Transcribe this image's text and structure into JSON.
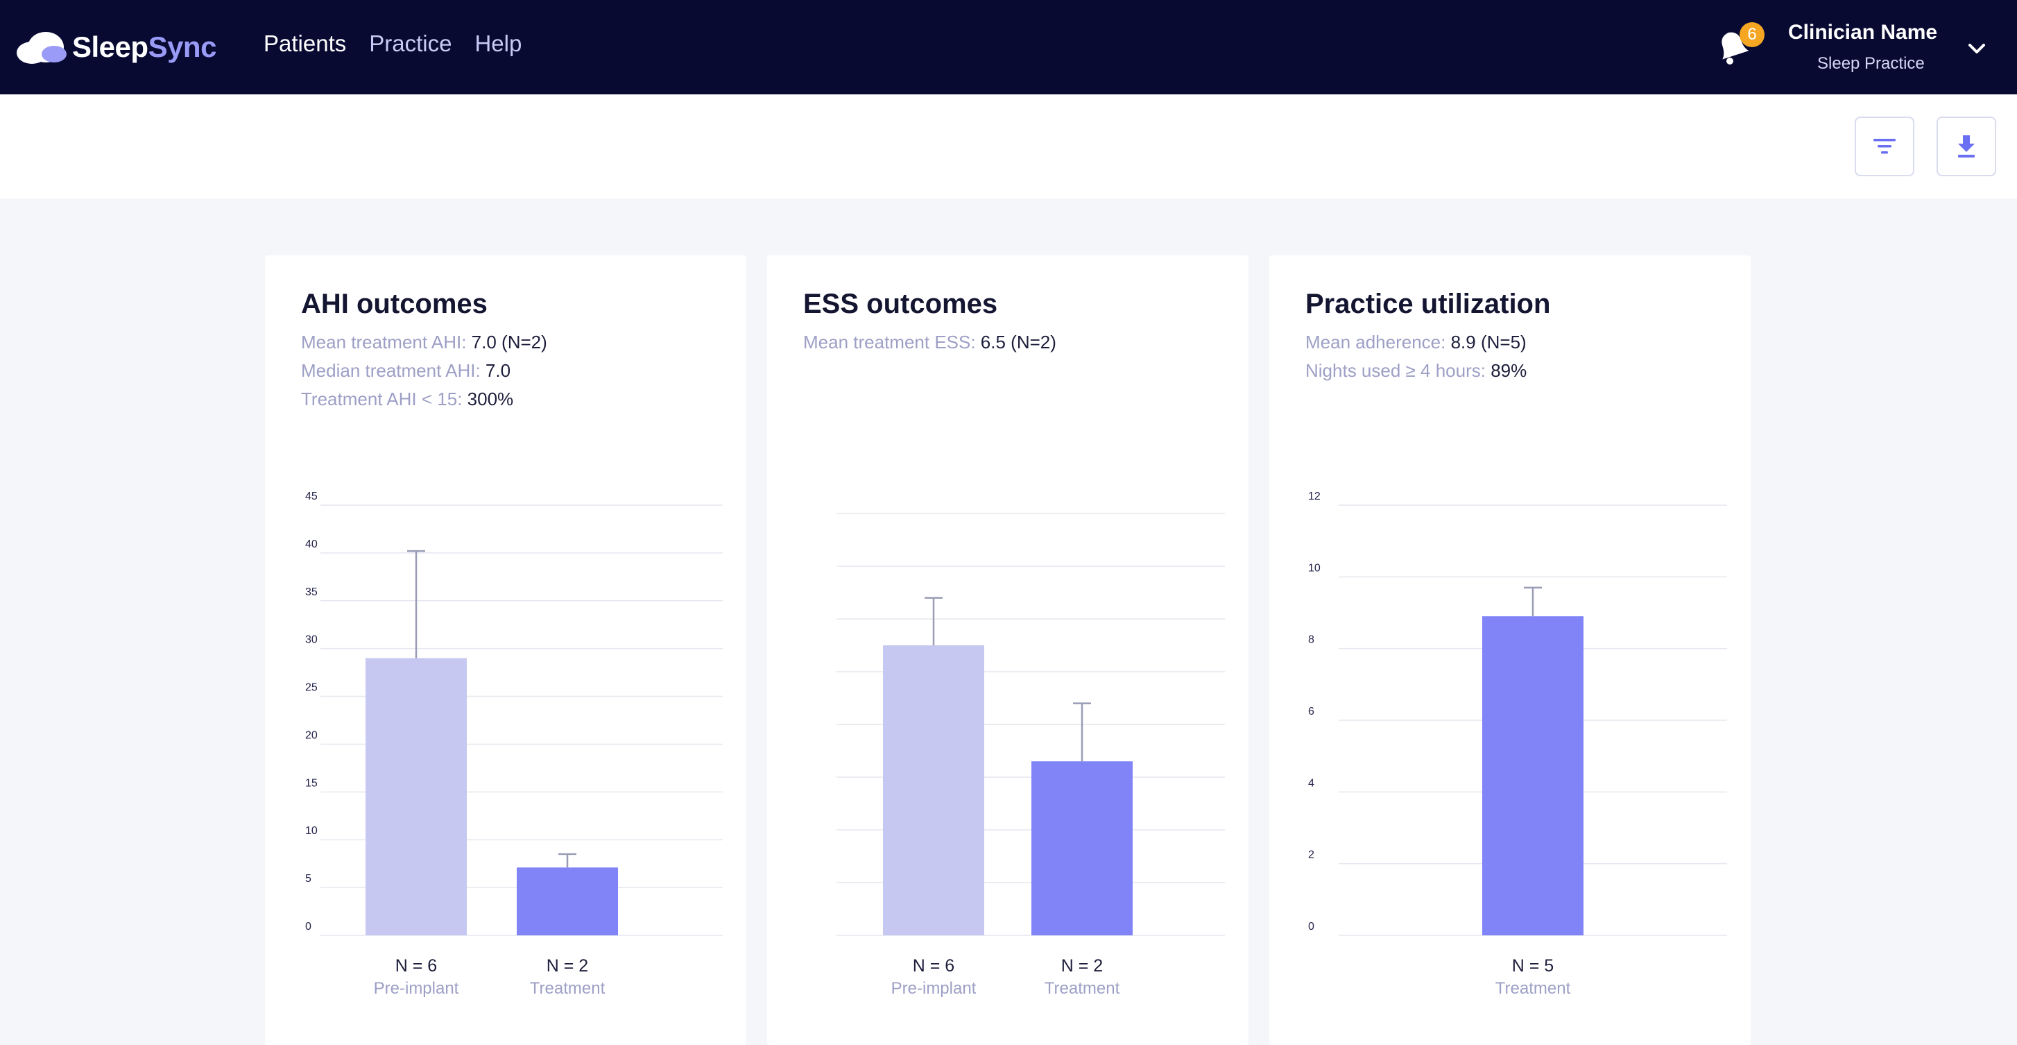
{
  "app": {
    "brand_part1": "Sleep",
    "brand_part2": "Sync",
    "nav": [
      "Patients",
      "Practice",
      "Help"
    ],
    "notifications_count": "6",
    "user_name": "Clinician Name",
    "user_org": "Sleep Practice",
    "icons": [
      "logo-cloud-icon",
      "bell-icon",
      "chevron-down-icon",
      "filter-icon",
      "download-icon"
    ],
    "colors": {
      "header_bg": "#080a32",
      "accent": "#8084f7",
      "accent_light": "#c7c8f2",
      "badge": "#f5a623"
    }
  },
  "cards": [
    {
      "title": "AHI outcomes",
      "stats": [
        {
          "label": "Mean treatment AHI: ",
          "value": "7.0 (N=2)"
        },
        {
          "label": "Median treatment AHI: ",
          "value": "7.0"
        },
        {
          "label": "Treatment AHI < 15: ",
          "value": "300%"
        }
      ]
    },
    {
      "title": "ESS outcomes",
      "stats": [
        {
          "label": "Mean treatment ESS: ",
          "value": "6.5 (N=2)"
        }
      ]
    },
    {
      "title": "Practice utilization",
      "stats": [
        {
          "label": "Mean adherence: ",
          "value": "8.9 (N=5)"
        },
        {
          "label": "Nights used ≥ 4 hours: ",
          "value": "89%"
        }
      ]
    }
  ],
  "chart_data": [
    {
      "type": "bar",
      "ylim": [
        0,
        45
      ],
      "yticks": [
        "0",
        "5",
        "10",
        "15",
        "20",
        "25",
        "30",
        "35",
        "40",
        "45"
      ],
      "categories": [
        "Pre-implant",
        "Treatment"
      ],
      "n_labels": [
        "N = 6",
        "N = 2"
      ],
      "values": [
        29,
        7.1
      ],
      "error_upper": [
        40.2,
        8.5
      ],
      "bar_colors": [
        "#c7c8f2",
        "#8084f7"
      ]
    },
    {
      "type": "bar",
      "ylim": [
        0,
        8
      ],
      "yticks": [],
      "categories": [
        "Pre-implant",
        "Treatment"
      ],
      "n_labels": [
        "N = 6",
        "N = 2"
      ],
      "values": [
        5.5,
        3.3
      ],
      "error_upper": [
        6.4,
        4.4
      ],
      "bar_colors": [
        "#c7c8f2",
        "#8084f7"
      ]
    },
    {
      "type": "bar",
      "ylim": [
        0,
        12
      ],
      "yticks": [
        "0",
        "2",
        "4",
        "6",
        "8",
        "10",
        "12"
      ],
      "categories": [
        "Treatment"
      ],
      "n_labels": [
        "N = 5"
      ],
      "values": [
        8.9
      ],
      "error_upper": [
        9.7
      ],
      "bar_colors": [
        "#8084f7"
      ]
    }
  ]
}
